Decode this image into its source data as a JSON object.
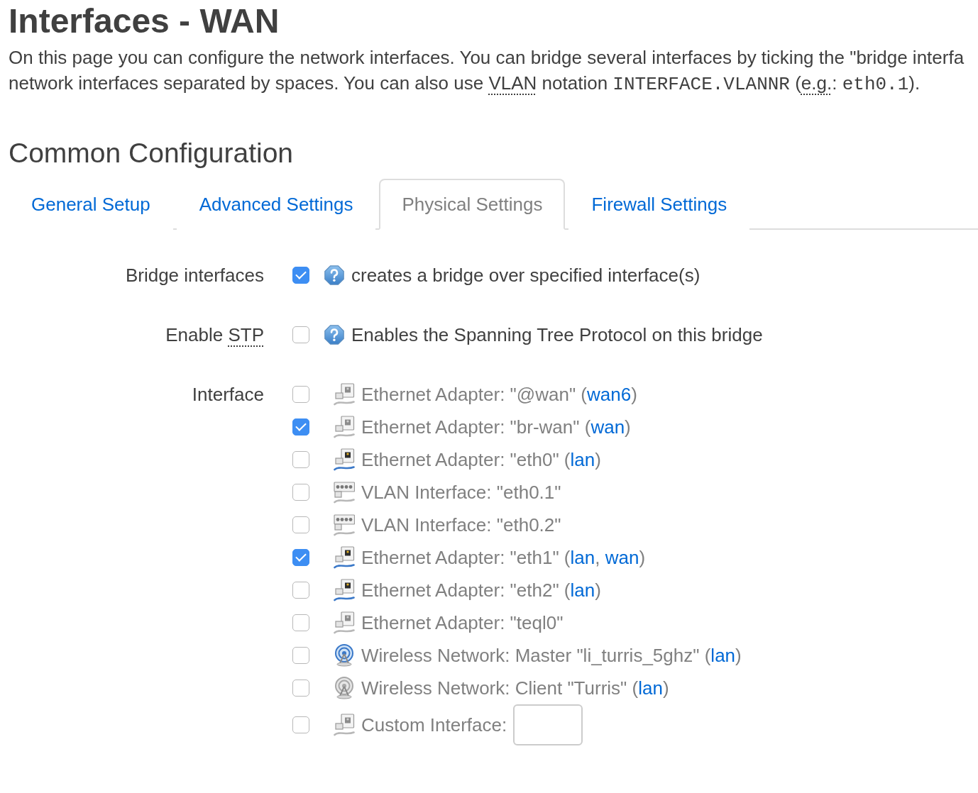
{
  "title": "Interfaces - WAN",
  "description": [
    [
      {
        "kind": "text",
        "text": "On this page you can configure the network interfaces. You can bridge several interfaces by ticking the \"bridge interfa"
      }
    ],
    [
      {
        "kind": "text",
        "text": "network interfaces separated by spaces. You can also use "
      },
      {
        "kind": "abbr",
        "text": "VLAN"
      },
      {
        "kind": "text",
        "text": " notation "
      },
      {
        "kind": "code",
        "text": "INTERFACE.VLANNR"
      },
      {
        "kind": "text",
        "text": " ("
      },
      {
        "kind": "abbr",
        "text": "e.g."
      },
      {
        "kind": "text",
        "text": ": "
      },
      {
        "kind": "code",
        "text": "eth0.1"
      },
      {
        "kind": "text",
        "text": ")."
      }
    ]
  ],
  "section": {
    "title": "Common Configuration",
    "tabs": [
      {
        "label": "General Setup",
        "selected": false
      },
      {
        "label": "Advanced Settings",
        "selected": false
      },
      {
        "label": "Physical Settings",
        "selected": true
      },
      {
        "label": "Firewall Settings",
        "selected": false
      }
    ],
    "fields": [
      {
        "kind": "checkbox",
        "label": [
          {
            "kind": "text",
            "text": "Bridge interfaces"
          }
        ],
        "checked": true,
        "help": "creates a bridge over specified interface(s)"
      },
      {
        "kind": "checkbox",
        "label": [
          {
            "kind": "text",
            "text": "Enable "
          },
          {
            "kind": "abbr",
            "text": "STP"
          }
        ],
        "checked": false,
        "help": "Enables the Spanning Tree Protocol on this bridge"
      },
      {
        "kind": "interfaces",
        "label": [
          {
            "kind": "text",
            "text": "Interface"
          }
        ],
        "items": [
          {
            "kind": "ethernet",
            "active": false,
            "checked": false,
            "text": [
              {
                "kind": "text",
                "text": "Ethernet Adapter: \"@wan\" ("
              },
              {
                "kind": "link",
                "text": "wan6"
              },
              {
                "kind": "text",
                "text": ")"
              }
            ]
          },
          {
            "kind": "ethernet",
            "active": false,
            "checked": true,
            "text": [
              {
                "kind": "text",
                "text": "Ethernet Adapter: \"br-wan\" ("
              },
              {
                "kind": "link",
                "text": "wan"
              },
              {
                "kind": "text",
                "text": ")"
              }
            ]
          },
          {
            "kind": "ethernet",
            "active": true,
            "checked": false,
            "text": [
              {
                "kind": "text",
                "text": "Ethernet Adapter: \"eth0\" ("
              },
              {
                "kind": "link",
                "text": "lan"
              },
              {
                "kind": "text",
                "text": ")"
              }
            ]
          },
          {
            "kind": "vlan",
            "active": false,
            "checked": false,
            "text": [
              {
                "kind": "text",
                "text": "VLAN Interface: \"eth0.1\""
              }
            ]
          },
          {
            "kind": "vlan",
            "active": false,
            "checked": false,
            "text": [
              {
                "kind": "text",
                "text": "VLAN Interface: \"eth0.2\""
              }
            ]
          },
          {
            "kind": "ethernet",
            "active": true,
            "checked": true,
            "text": [
              {
                "kind": "text",
                "text": "Ethernet Adapter: \"eth1\" ("
              },
              {
                "kind": "link",
                "text": "lan"
              },
              {
                "kind": "text",
                "text": ", "
              },
              {
                "kind": "link",
                "text": "wan"
              },
              {
                "kind": "text",
                "text": ")"
              }
            ]
          },
          {
            "kind": "ethernet",
            "active": true,
            "checked": false,
            "text": [
              {
                "kind": "text",
                "text": "Ethernet Adapter: \"eth2\" ("
              },
              {
                "kind": "link",
                "text": "lan"
              },
              {
                "kind": "text",
                "text": ")"
              }
            ]
          },
          {
            "kind": "ethernet",
            "active": false,
            "checked": false,
            "text": [
              {
                "kind": "text",
                "text": "Ethernet Adapter: \"teql0\""
              }
            ]
          },
          {
            "kind": "wireless",
            "active": true,
            "checked": false,
            "text": [
              {
                "kind": "text",
                "text": "Wireless Network: Master \"li_turris_5ghz\" ("
              },
              {
                "kind": "link",
                "text": "lan"
              },
              {
                "kind": "text",
                "text": ")"
              }
            ]
          },
          {
            "kind": "wireless",
            "active": false,
            "checked": false,
            "text": [
              {
                "kind": "text",
                "text": "Wireless Network: Client \"Turris\" ("
              },
              {
                "kind": "link",
                "text": "lan"
              },
              {
                "kind": "text",
                "text": ")"
              }
            ]
          },
          {
            "kind": "custom",
            "active": false,
            "checked": false,
            "text": [
              {
                "kind": "text",
                "text": "Custom Interface:"
              }
            ]
          }
        ]
      }
    ]
  }
}
